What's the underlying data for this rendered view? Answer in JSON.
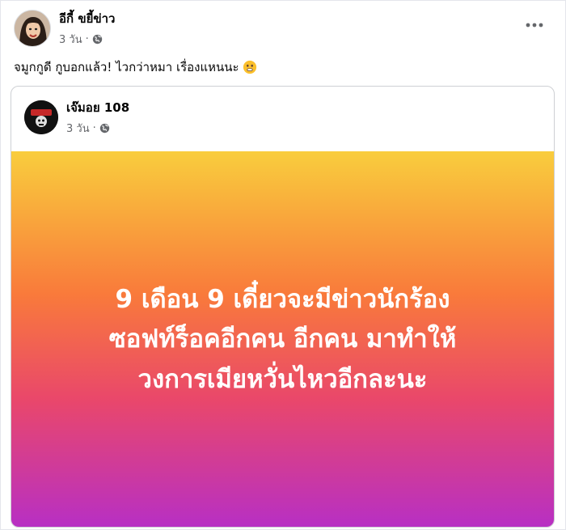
{
  "post": {
    "author_name": "อีกี้ ขยี้ข่าว",
    "timestamp": "3 วัน",
    "separator": "·",
    "privacy_icon": "globe-icon",
    "more_icon": "more-options-icon",
    "text": "จมูกกูดี กูบอกแล้ว! ไวกว่าหมา เรื่องแหนนะ",
    "emoji": "shushing-face-emoji"
  },
  "shared_post": {
    "author_name": "เจ๊มอย 108",
    "timestamp": "3 วัน",
    "separator": "·",
    "privacy_icon": "globe-icon",
    "lines": [
      "9 เดือน 9 เดี๋ยวจะมีข่าวนักร้อง",
      "ซอฟท์ร็อคอีกคน อีกคน มาทำให้",
      "วงการเมียหวั่นไหวอีกละนะ"
    ],
    "gradient_colors": [
      "#f9cd3d",
      "#f97a3b",
      "#e9476b",
      "#b72fc5"
    ]
  }
}
